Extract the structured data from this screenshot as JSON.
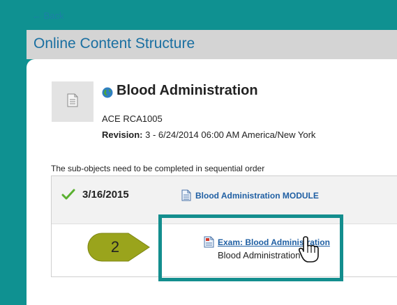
{
  "nav": {
    "back_label": "← Back"
  },
  "header": {
    "title": "Online Content Structure"
  },
  "course": {
    "title": "Blood Administration",
    "code": "ACE RCA1005",
    "revision_label": "Revision:",
    "revision_value": "3 - 6/24/2014 06:00 AM America/New York"
  },
  "structure": {
    "note": "The sub-objects need to be completed in sequential order",
    "items": [
      {
        "status_icon": "check-icon",
        "date": "3/16/2015",
        "icon": "document-icon",
        "title": "Blood Administration MODULE"
      },
      {
        "icon": "exam-document-icon",
        "title": "Exam: Blood Administration",
        "subtitle": "Blood Administration"
      }
    ]
  },
  "annotation": {
    "step_number": "2"
  },
  "colors": {
    "background": "#0f9191",
    "header_bar": "#d4d4d4",
    "title_blue": "#1a6fa1",
    "link_blue": "#1f5fa3",
    "check_green": "#5ab030",
    "callout_olive": "#9aa41c",
    "highlight_teal": "#138e8e"
  }
}
